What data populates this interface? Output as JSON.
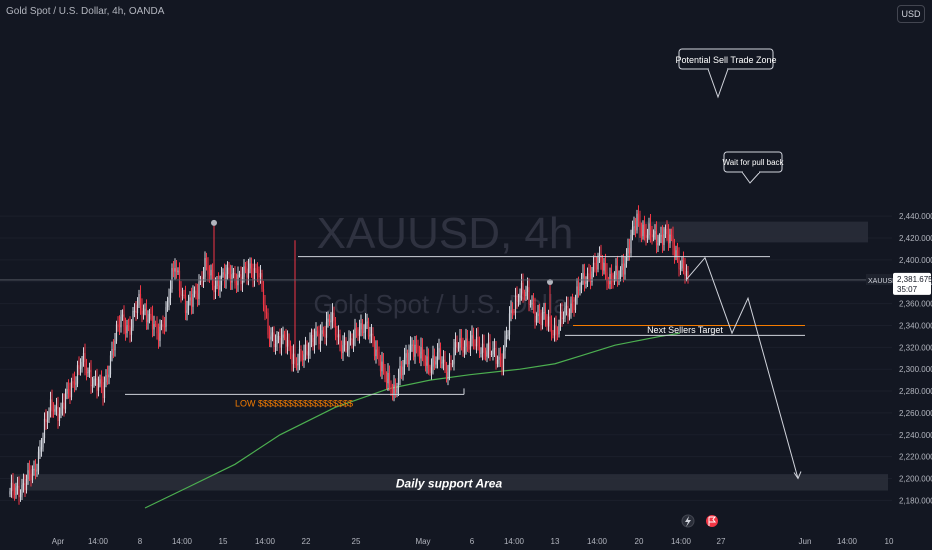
{
  "header": {
    "title": "Gold Spot / U.S. Dollar, 4h, OANDA",
    "currency": "USD"
  },
  "watermark": {
    "symbol": "XAUUSD, 4h",
    "name": "Gold Spot / U.S. Dollar"
  },
  "price_label": {
    "symbol": "XAUUSD",
    "price": "2,381.675",
    "countdown": "35:07"
  },
  "icons": [
    "lightning-icon",
    "flag-icon"
  ],
  "colors": {
    "background": "#131722",
    "bull": "#d1d4dc",
    "bear": "#f23645",
    "ma": "#4caf50",
    "level": "#d1d4dc",
    "target_line": "#f57c00",
    "low_label": "#f57c00"
  },
  "chart_data": {
    "type": "candlestick",
    "title": "Gold Spot / U.S. Dollar, 4h, OANDA",
    "ylim": [
      2170,
      2450
    ],
    "y_ticks": [
      2180,
      2200,
      2220,
      2240,
      2260,
      2280,
      2300,
      2320,
      2340,
      2360,
      2380,
      2400,
      2420,
      2440
    ],
    "x_tick_labels": [
      "Apr",
      "14:00",
      "8",
      "14:00",
      "15",
      "14:00",
      "22",
      "25",
      "May",
      "6",
      "14:00",
      "13",
      "14:00",
      "20",
      "14:00",
      "27",
      "Jun",
      "14:00",
      "10"
    ],
    "current_price": 2381.675,
    "path_points": [
      [
        0,
        2185
      ],
      [
        8,
        2193
      ],
      [
        16,
        2205
      ],
      [
        22,
        2240
      ],
      [
        28,
        2268
      ],
      [
        34,
        2260
      ],
      [
        42,
        2290
      ],
      [
        48,
        2305
      ],
      [
        56,
        2290
      ],
      [
        62,
        2278
      ],
      [
        68,
        2318
      ],
      [
        74,
        2345
      ],
      [
        80,
        2338
      ],
      [
        86,
        2360
      ],
      [
        92,
        2350
      ],
      [
        98,
        2330
      ],
      [
        104,
        2352
      ],
      [
        110,
        2395
      ],
      [
        114,
        2375
      ],
      [
        118,
        2352
      ],
      [
        124,
        2372
      ],
      [
        130,
        2392
      ],
      [
        136,
        2378
      ],
      [
        142,
        2382
      ],
      [
        148,
        2388
      ],
      [
        154,
        2380
      ],
      [
        160,
        2395
      ],
      [
        166,
        2385
      ],
      [
        172,
        2338
      ],
      [
        178,
        2320
      ],
      [
        184,
        2332
      ],
      [
        190,
        2300
      ],
      [
        196,
        2318
      ],
      [
        202,
        2324
      ],
      [
        208,
        2335
      ],
      [
        214,
        2345
      ],
      [
        220,
        2325
      ],
      [
        226,
        2318
      ],
      [
        232,
        2340
      ],
      [
        238,
        2335
      ],
      [
        244,
        2320
      ],
      [
        250,
        2290
      ],
      [
        256,
        2282
      ],
      [
        262,
        2300
      ],
      [
        268,
        2325
      ],
      [
        274,
        2310
      ],
      [
        280,
        2305
      ],
      [
        286,
        2310
      ],
      [
        292,
        2300
      ],
      [
        298,
        2320
      ],
      [
        304,
        2326
      ],
      [
        310,
        2322
      ],
      [
        316,
        2320
      ],
      [
        322,
        2312
      ],
      [
        328,
        2310
      ],
      [
        334,
        2348
      ],
      [
        340,
        2375
      ],
      [
        346,
        2362
      ],
      [
        352,
        2350
      ],
      [
        358,
        2342
      ],
      [
        364,
        2336
      ],
      [
        370,
        2350
      ],
      [
        376,
        2363
      ],
      [
        382,
        2380
      ],
      [
        388,
        2392
      ],
      [
        394,
        2398
      ],
      [
        400,
        2382
      ],
      [
        406,
        2384
      ],
      [
        412,
        2410
      ],
      [
        418,
        2435
      ],
      [
        424,
        2426
      ],
      [
        430,
        2418
      ],
      [
        436,
        2425
      ],
      [
        442,
        2412
      ],
      [
        448,
        2395
      ],
      [
        452,
        2382
      ]
    ],
    "moving_average": [
      [
        2173,
        145
      ],
      [
        2192,
        188
      ],
      [
        2213,
        235
      ],
      [
        2240,
        280
      ],
      [
        2265,
        335
      ],
      [
        2282,
        388
      ],
      [
        2290,
        430
      ],
      [
        2295,
        470
      ],
      [
        2300,
        520
      ],
      [
        2305,
        555
      ],
      [
        2312,
        580
      ],
      [
        2322,
        615
      ],
      [
        2330,
        660
      ],
      [
        2333,
        680
      ]
    ],
    "projection": [
      2381.675,
      2402,
      2333,
      2365,
      2200
    ],
    "levels": [
      {
        "price": 2403,
        "label": ""
      },
      {
        "price": 2277,
        "label": "LOW $$$$$$$$$$$$$$$$$$$"
      },
      {
        "price": 2340,
        "label": ""
      },
      {
        "price": 2331,
        "label": "Next Sellers Target"
      }
    ],
    "zones": [
      {
        "label": "Potential Sell Trade Zone",
        "from": 2416,
        "to": 2435
      },
      {
        "label": "Daily support Area",
        "from": 2189,
        "to": 2204
      }
    ],
    "annotations": [
      "Potential Sell Trade Zone",
      "Wait for pull back",
      "Next Sellers Target",
      "LOW $$$$$$$$$$$$$$$$$$$",
      "Daily support Area"
    ]
  }
}
